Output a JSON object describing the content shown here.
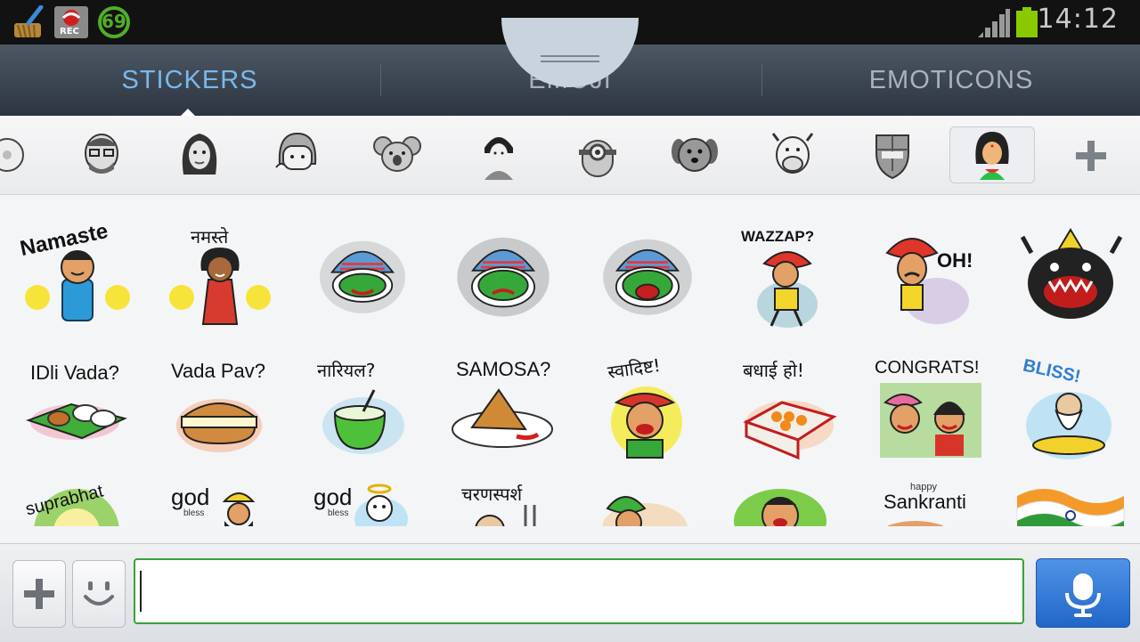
{
  "status_bar": {
    "time": "14:12",
    "notification_icons": [
      "broom-icon",
      "call-recorder-icon",
      "badge-69-icon"
    ],
    "badge_number": "69",
    "rec_label": "REC",
    "battery_color": "#8ac800"
  },
  "tabs": [
    {
      "label": "STICKERS",
      "active": true
    },
    {
      "label": "EMOJI",
      "active": false
    },
    {
      "label": "EMOTICONS",
      "active": false
    }
  ],
  "sticker_packs": [
    "face-partial-icon",
    "bearded-man-face-icon",
    "woman-face-icon",
    "girl-bob-face-icon",
    "koala-icon",
    "geisha-icon",
    "minion-icon",
    "puppy-icon",
    "cow-icon",
    "fcb-crest-icon",
    "indian-woman-face-icon"
  ],
  "add_pack_icon": "plus-icon",
  "stickers": [
    {
      "name": "namaste-man-sticker",
      "caption": "Namaste"
    },
    {
      "name": "namaste-woman-sticker",
      "caption": "नमस्ते"
    },
    {
      "name": "kathakali-smile-sticker",
      "caption": ""
    },
    {
      "name": "kathakali-sad-sticker",
      "caption": ""
    },
    {
      "name": "kathakali-shout-sticker",
      "caption": ""
    },
    {
      "name": "wazzap-sticker",
      "caption": "WAZZAP?"
    },
    {
      "name": "oh-turban-sticker",
      "caption": "OH!"
    },
    {
      "name": "angry-bull-sticker",
      "caption": ""
    },
    {
      "name": "idli-vada-sticker",
      "caption": "IDli Vada?"
    },
    {
      "name": "vada-pav-sticker",
      "caption": "Vada Pav?"
    },
    {
      "name": "nariyal-sticker",
      "caption": "नारियल?"
    },
    {
      "name": "samosa-sticker",
      "caption": "SAMOSA?"
    },
    {
      "name": "swadisht-sticker",
      "caption": "स्वादिष्ट!"
    },
    {
      "name": "badhai-ho-sticker",
      "caption": "बधाई हो!"
    },
    {
      "name": "congrats-sticker",
      "caption": "CONGRATS!"
    },
    {
      "name": "bliss-sticker",
      "caption": "BLISS!"
    },
    {
      "name": "suprabhat-sticker",
      "caption": "suprabhat"
    },
    {
      "name": "god-bless-sikh-sticker",
      "caption": "god"
    },
    {
      "name": "god-bless-angel-sticker",
      "caption": "god"
    },
    {
      "name": "charansparsh-sticker",
      "caption": "चरणस्पर्श"
    },
    {
      "name": "turban-man-sticker",
      "caption": ""
    },
    {
      "name": "laughing-man-sticker",
      "caption": ""
    },
    {
      "name": "happy-sankranti-sticker",
      "caption": "Sankranti"
    },
    {
      "name": "india-flag-sticker",
      "caption": ""
    }
  ],
  "small_captions": {
    "bless": "bless",
    "happy": "happy"
  },
  "input": {
    "placeholder": "",
    "value": ""
  },
  "colors": {
    "active_tab": "#79b8ec",
    "input_border": "#3aa13a",
    "mic_button": "#2f7bd9"
  }
}
